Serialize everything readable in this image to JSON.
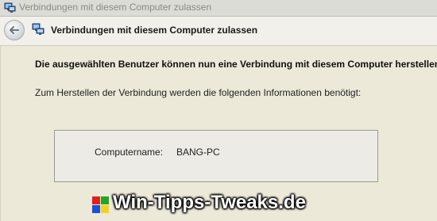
{
  "window": {
    "title": "Verbindungen mit diesem Computer zulassen",
    "icon": "network-computer-icon"
  },
  "nav": {
    "back_icon": "back-arrow-icon",
    "page_icon": "network-computer-icon",
    "page_title": "Verbindungen mit diesem Computer zulassen"
  },
  "content": {
    "confirmation": "Die ausgewählten Benutzer können nun eine Verbindung mit diesem Computer herstellen.",
    "info_text": "Zum Herstellen der Verbindung werden die folgenden Informationen benötigt:",
    "computer_name_label": "Computername:",
    "computer_name_value": "BANG-PC"
  },
  "watermark": {
    "text": "Win-Tipps-Tweaks.de",
    "logo_colors": [
      "#e02020",
      "#1fa81f",
      "#1a4fd6",
      "#f3d21a"
    ]
  }
}
